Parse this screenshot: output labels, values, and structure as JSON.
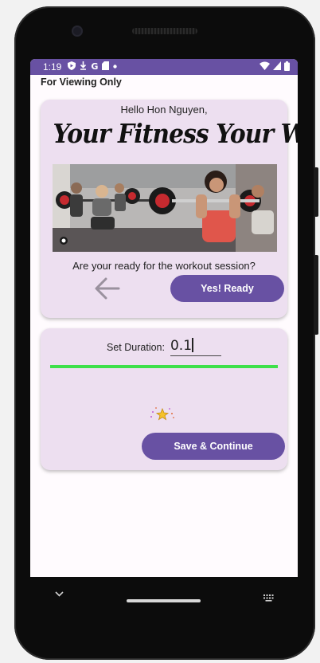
{
  "status_bar": {
    "time": "1:19",
    "icons_left": [
      "shield-icon",
      "download-icon",
      "google-icon",
      "sd-card-icon",
      "dot-icon"
    ],
    "icons_right": [
      "wifi-icon",
      "signal-icon",
      "battery-icon"
    ],
    "color": "#6851a3"
  },
  "page": {
    "header": "For Viewing Only"
  },
  "intro_card": {
    "greeting": "Hello Hon Nguyen,",
    "headline": "Your Fitness Your Way",
    "question": "Are your ready for the workout session?",
    "back_icon": "arrow-left-icon",
    "yes_button": "Yes! Ready"
  },
  "duration_card": {
    "label": "Set Duration:",
    "value": "0.1",
    "progress_percent": 100,
    "progress_color": "#3ee04a",
    "sparkle_icon": "star-sparkle-icon",
    "save_button": "Save & Continue"
  },
  "nav_bar": {
    "icons": [
      "chevron-down-icon",
      "home-pill-icon",
      "keyboard-icon"
    ]
  },
  "colors": {
    "accent": "#6851a3",
    "card": "#eddff0",
    "screen": "#fffbfe"
  }
}
